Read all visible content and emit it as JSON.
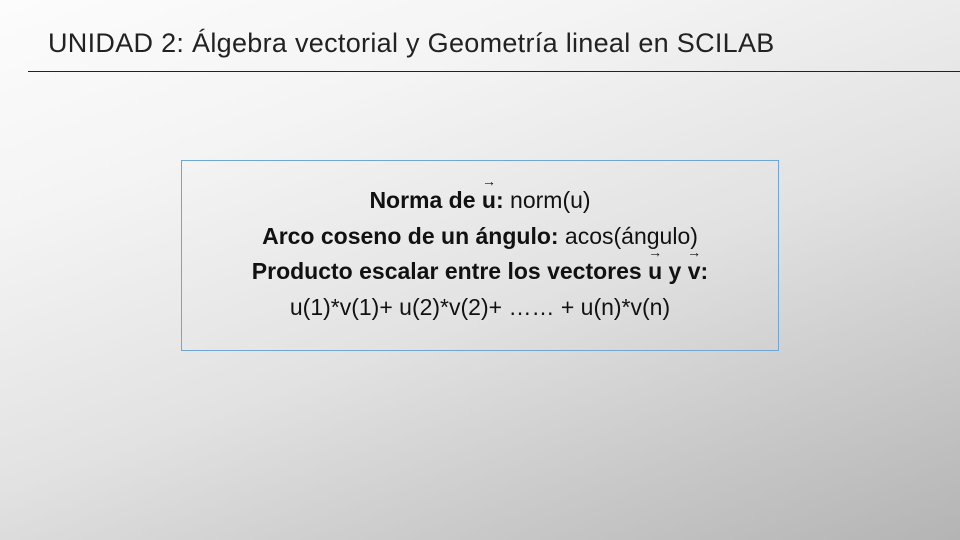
{
  "heading": {
    "unit_label": "UNIDAD 2:",
    "title_rest": " Álgebra vectorial y Geometría lineal en SCILAB"
  },
  "box": {
    "line1": {
      "label_prefix": "Norma de ",
      "label_vec": "u",
      "label_suffix": ":",
      "code": " norm(u)"
    },
    "line2": {
      "label": "Arco coseno de un ángulo:",
      "code": " acos(ángulo)"
    },
    "line3": {
      "label_prefix": "Producto escalar entre los vectores ",
      "label_vec1": "u",
      "label_mid": " y ",
      "label_vec2": "v",
      "label_suffix": ":"
    },
    "line4": {
      "expr": "u(1)*v(1)+ u(2)*v(2)+ …… + u(n)*v(n)"
    }
  },
  "glyphs": {
    "arrow": "→"
  }
}
